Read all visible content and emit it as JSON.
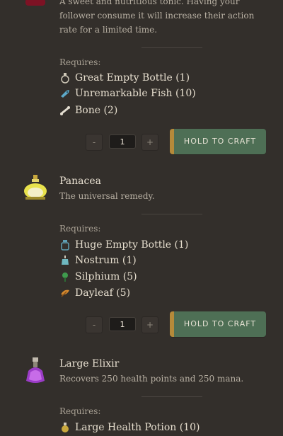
{
  "recipes": [
    {
      "title": "",
      "description": "A sweet and nutritious tonic. Having your follower consume it will increase their action rate for a limited time.",
      "requires_label": "Requires:",
      "ingredients": [
        {
          "icon": "bottle-icon",
          "label": "Great Empty Bottle (1)"
        },
        {
          "icon": "fish-icon",
          "label": "Unremarkable Fish (10)"
        },
        {
          "icon": "bone-icon",
          "label": "Bone (2)"
        }
      ],
      "quantity": "1",
      "minus_label": "-",
      "plus_label": "+",
      "craft_label": "HOLD TO CRAFT"
    },
    {
      "title": "Panacea",
      "description": "The universal remedy.",
      "requires_label": "Requires:",
      "ingredients": [
        {
          "icon": "huge-bottle-icon",
          "label": "Huge Empty Bottle (1)"
        },
        {
          "icon": "nostrum-icon",
          "label": "Nostrum (1)"
        },
        {
          "icon": "silphium-icon",
          "label": "Silphium (5)"
        },
        {
          "icon": "dayleaf-icon",
          "label": "Dayleaf (5)"
        }
      ],
      "quantity": "1",
      "minus_label": "-",
      "plus_label": "+",
      "craft_label": "HOLD TO CRAFT"
    },
    {
      "title": "Large Elixir",
      "description": "Recovers 250 health points and 250 mana.",
      "requires_label": "Requires:",
      "ingredients": [
        {
          "icon": "bottle-icon",
          "label": "Large Health Potion (10)"
        }
      ]
    }
  ],
  "colors": {
    "background": "#332f2b",
    "craft_button": "#4e6f55",
    "craft_accent": "#b58a3a"
  }
}
